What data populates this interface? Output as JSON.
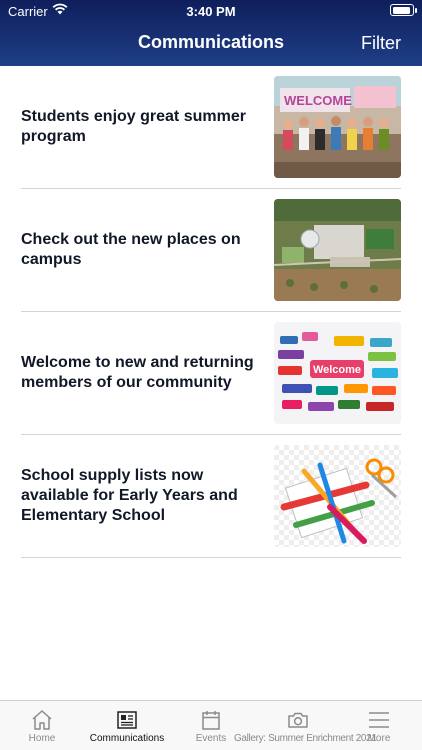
{
  "status_bar": {
    "carrier": "Carrier",
    "time": "3:40 PM"
  },
  "nav": {
    "title": "Communications",
    "filter_label": "Filter"
  },
  "posts": [
    {
      "title": "Students enjoy great summer program",
      "image_icon": "group-photo"
    },
    {
      "title": "Check out the new places on campus",
      "image_icon": "aerial-campus"
    },
    {
      "title": "Welcome to new and returning members of our community",
      "image_icon": "welcome-speech-bubbles",
      "image_text": "Welcome"
    },
    {
      "title": "School supply lists now available for Early Years and Elementary School",
      "image_icon": "school-supplies"
    }
  ],
  "tabs": [
    {
      "label": "Home",
      "icon": "house-icon"
    },
    {
      "label": "Communications",
      "icon": "newspaper-icon",
      "active": true
    },
    {
      "label": "Events",
      "icon": "calendar-icon"
    },
    {
      "label": "Gallery: Summer Enrichment 2021",
      "icon": "camera-icon"
    },
    {
      "label": "More",
      "icon": "menu-icon"
    }
  ],
  "colors": {
    "header_top": "#0f1e5b",
    "header_bottom": "#1f3f86",
    "title_text": "#111827",
    "divider": "#d4d4d4"
  }
}
